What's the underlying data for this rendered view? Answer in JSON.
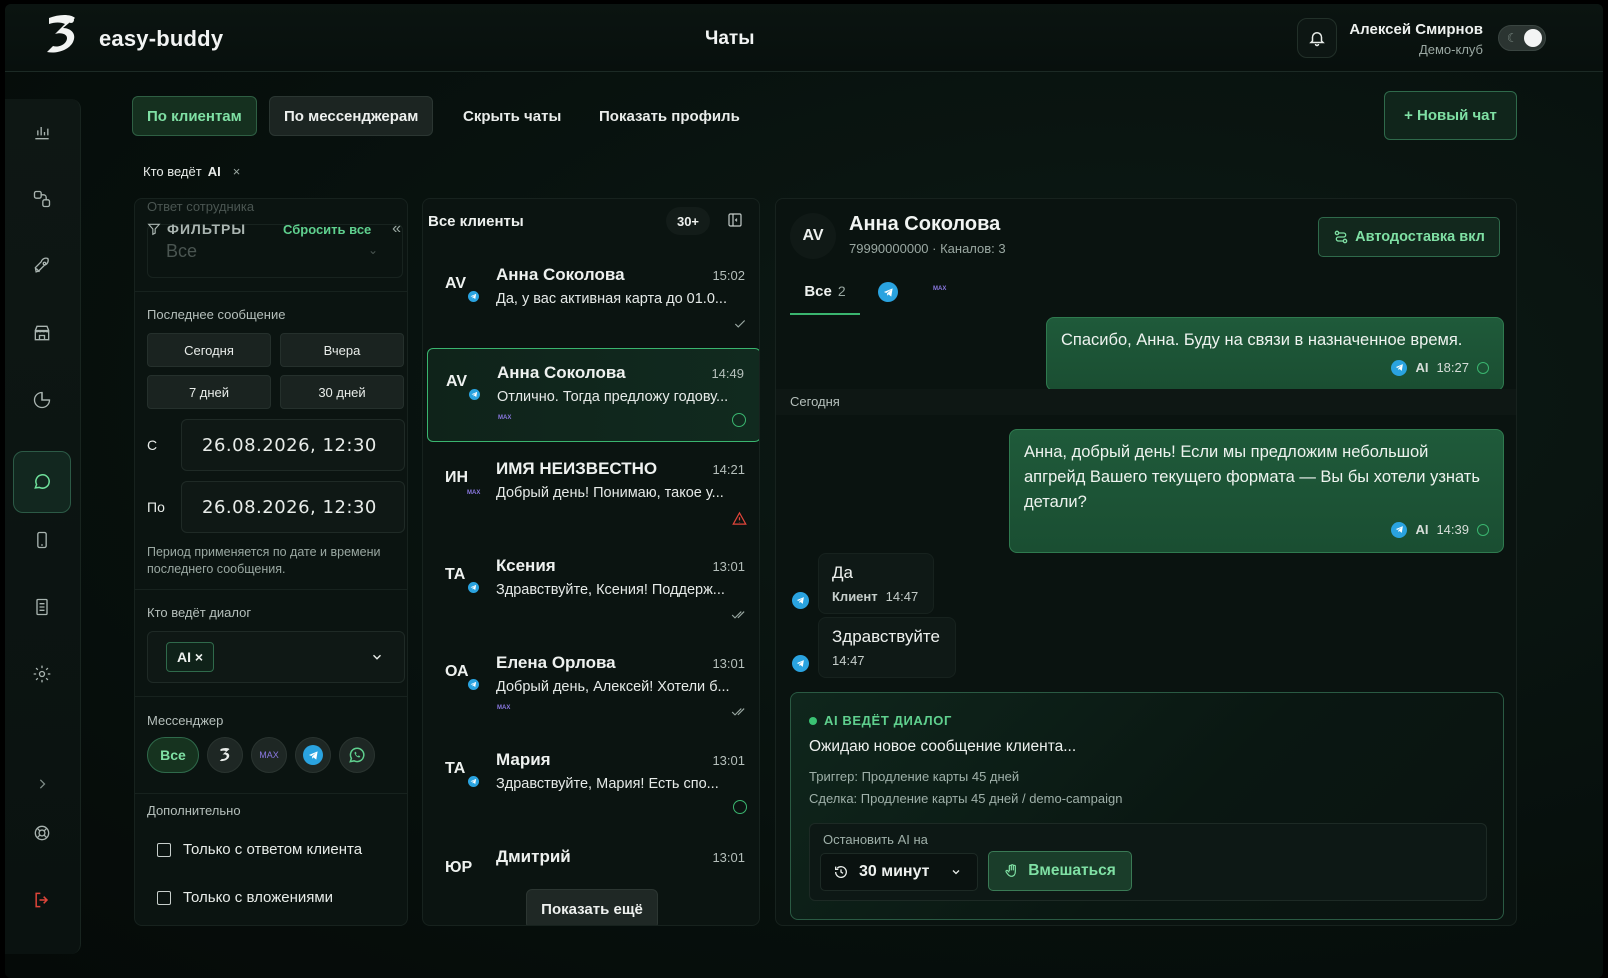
{
  "app": {
    "name": "easy-buddy",
    "page_title": "Чаты"
  },
  "user": {
    "name": "Алексей Смирнов",
    "club": "Демо-клуб"
  },
  "colors": {
    "accent": "#3ab56f",
    "accent_text": "#7fe0a4",
    "telegram": "#2aa3e0",
    "max": "#8a78e0",
    "warning": "#e0453a"
  },
  "sidebar": {
    "items": [
      {
        "icon": "analytics-icon"
      },
      {
        "icon": "connections-icon"
      },
      {
        "icon": "rocket-icon"
      },
      {
        "icon": "store-icon"
      },
      {
        "icon": "pie-chart-icon"
      },
      {
        "icon": "chat-icon",
        "active": true
      },
      {
        "icon": "phone-icon"
      },
      {
        "icon": "documents-icon"
      },
      {
        "icon": "settings-icon"
      }
    ],
    "expand_icon": "chevron-right-icon",
    "help_icon": "lifebuoy-icon",
    "logout_icon": "logout-icon"
  },
  "toolbar": {
    "by_clients": "По клиентам",
    "by_messengers": "По мессенджерам",
    "hide_chats": "Скрыть чаты",
    "show_profile": "Показать профиль",
    "new_chat": "+ Новый чат"
  },
  "active_filter": {
    "label": "Кто ведёт",
    "value": "AI",
    "remove": "×"
  },
  "filters": {
    "ghost_label": "Ответ сотрудника",
    "ghost_value": "Все",
    "title": "ФИЛЬТРЫ",
    "reset": "Сбросить все",
    "collapse": "«",
    "last_message_label": "Последнее сообщение",
    "ranges": [
      "Сегодня",
      "Вчера",
      "7 дней",
      "30 дней"
    ],
    "from_label": "С",
    "from_value": "26.08.2026, 12:30",
    "to_label": "По",
    "to_value": "26.08.2026, 12:30",
    "hint": "Период применяется по дате и времени последнего сообщения.",
    "who_label": "Кто ведёт диалог",
    "who_tag": "AI ×",
    "messenger_label": "Мессенджер",
    "messenger_all": "Все",
    "messenger_max": "MAX",
    "extra_label": "Дополнительно",
    "only_client_reply": "Только с ответом клиента",
    "only_attachments": "Только с вложениями"
  },
  "chat_list": {
    "title": "Все клиенты",
    "count": "30+",
    "show_more": "Показать ещё",
    "max_label": "MAX",
    "items": [
      {
        "initials": "AV",
        "name": "Анна Соколова",
        "time": "15:02",
        "snippet": "Да, у вас активная карта до 01.0...",
        "channel": "telegram",
        "status": "sent"
      },
      {
        "initials": "AV",
        "name": "Анна Соколова",
        "time": "14:49",
        "snippet": "Отлично. Тогда предложу годову...",
        "channel": "telegram",
        "max": true,
        "status": "ok",
        "active": true
      },
      {
        "initials": "ИН",
        "name": "ИМЯ НЕИЗВЕСТНО",
        "time": "14:21",
        "snippet": "Добрый день! Понимаю, такое у...",
        "channel": "max",
        "status": "warning"
      },
      {
        "initials": "ТА",
        "name": "Ксения",
        "time": "13:01",
        "snippet": "Здравствуйте, Ксения! Поддерж...",
        "channel": "telegram",
        "status": "read"
      },
      {
        "initials": "ОА",
        "name": "Елена Орлова",
        "time": "13:01",
        "snippet": "Добрый день, Алексей! Хотели б...",
        "channel": "telegram",
        "max": true,
        "status": "read"
      },
      {
        "initials": "ТА",
        "name": "Мария",
        "time": "13:01",
        "snippet": "Здравствуйте, Мария! Есть спо...",
        "channel": "telegram",
        "status": "ok"
      },
      {
        "initials": "ЮР",
        "name": "Дмитрий",
        "time": "13:01",
        "snippet": "",
        "channel": "",
        "status": ""
      }
    ]
  },
  "conversation": {
    "initials": "AV",
    "name": "Анна Соколова",
    "subtitle": "79990000000 · Каналов: 3",
    "autodelivery": "Автодоставка вкл",
    "tab_all": "Все",
    "tab_all_count": "2",
    "tab_max": "MAX",
    "day_separator": "Сегодня",
    "messages": [
      {
        "dir": "out",
        "text": "Спасибо, Анна. Буду на связи в назначенное время.",
        "author": "AI",
        "time": "18:27"
      },
      {
        "dir": "out",
        "text": "Анна, добрый день! Если мы предложим небольшой апгрейд Вашего текущего формата — Вы бы хотели узнать детали?",
        "author": "AI",
        "time": "14:39"
      },
      {
        "dir": "in",
        "text": "Да",
        "author": "Клиент",
        "time": "14:47"
      },
      {
        "dir": "in",
        "text": "Здравствуйте",
        "author": "",
        "time": "14:47"
      }
    ],
    "ai": {
      "badge": "AI ВЕДЁТ ДИАЛОГ",
      "status": "Ожидаю новое сообщение клиента...",
      "trigger": "Триггер: Продление карты 45 дней",
      "deal": "Сделка: Продление карты 45 дней / demo-campaign",
      "stop_label": "Остановить AI на",
      "duration": "30 минут",
      "intervene": "Вмешаться"
    }
  }
}
